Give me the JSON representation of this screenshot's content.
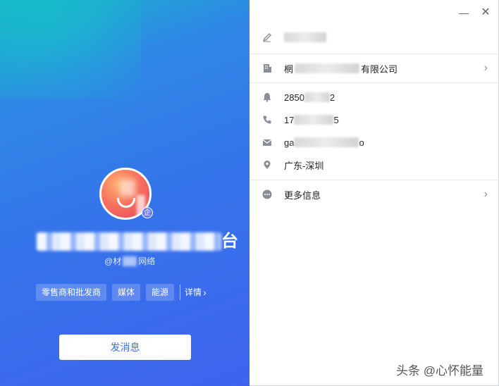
{
  "left_panel": {
    "verified_badge": "企",
    "name_suffix": "台",
    "handle_prefix": "@材",
    "handle_suffix": "网络",
    "tags": [
      "零售商和批发商",
      "媒体",
      "能源"
    ],
    "details_label": "详情",
    "send_message_label": "发消息",
    "gradient_colors": [
      "#18b6c8",
      "#3573ea",
      "#3f63ee"
    ]
  },
  "window_controls": {
    "minimize": "—",
    "close": "✕"
  },
  "profile_info": {
    "signature_prefix": "",
    "company": {
      "prefix": "棢",
      "suffix": "有限公司"
    },
    "qq": {
      "prefix": "2850",
      "suffix": "2"
    },
    "phone": {
      "prefix": "17",
      "suffix": "5"
    },
    "email": {
      "prefix": "ga",
      "suffix": "o"
    },
    "location": "广东-深圳",
    "more_info": "更多信息"
  },
  "icons": [
    "edit-icon",
    "building-icon",
    "bell-icon",
    "phone-icon",
    "mail-icon",
    "location-pin-icon",
    "more-dots-icon",
    "chevron-right-icon"
  ],
  "watermark": "头条 @心怀能量",
  "accent_color": "#3a74e8"
}
